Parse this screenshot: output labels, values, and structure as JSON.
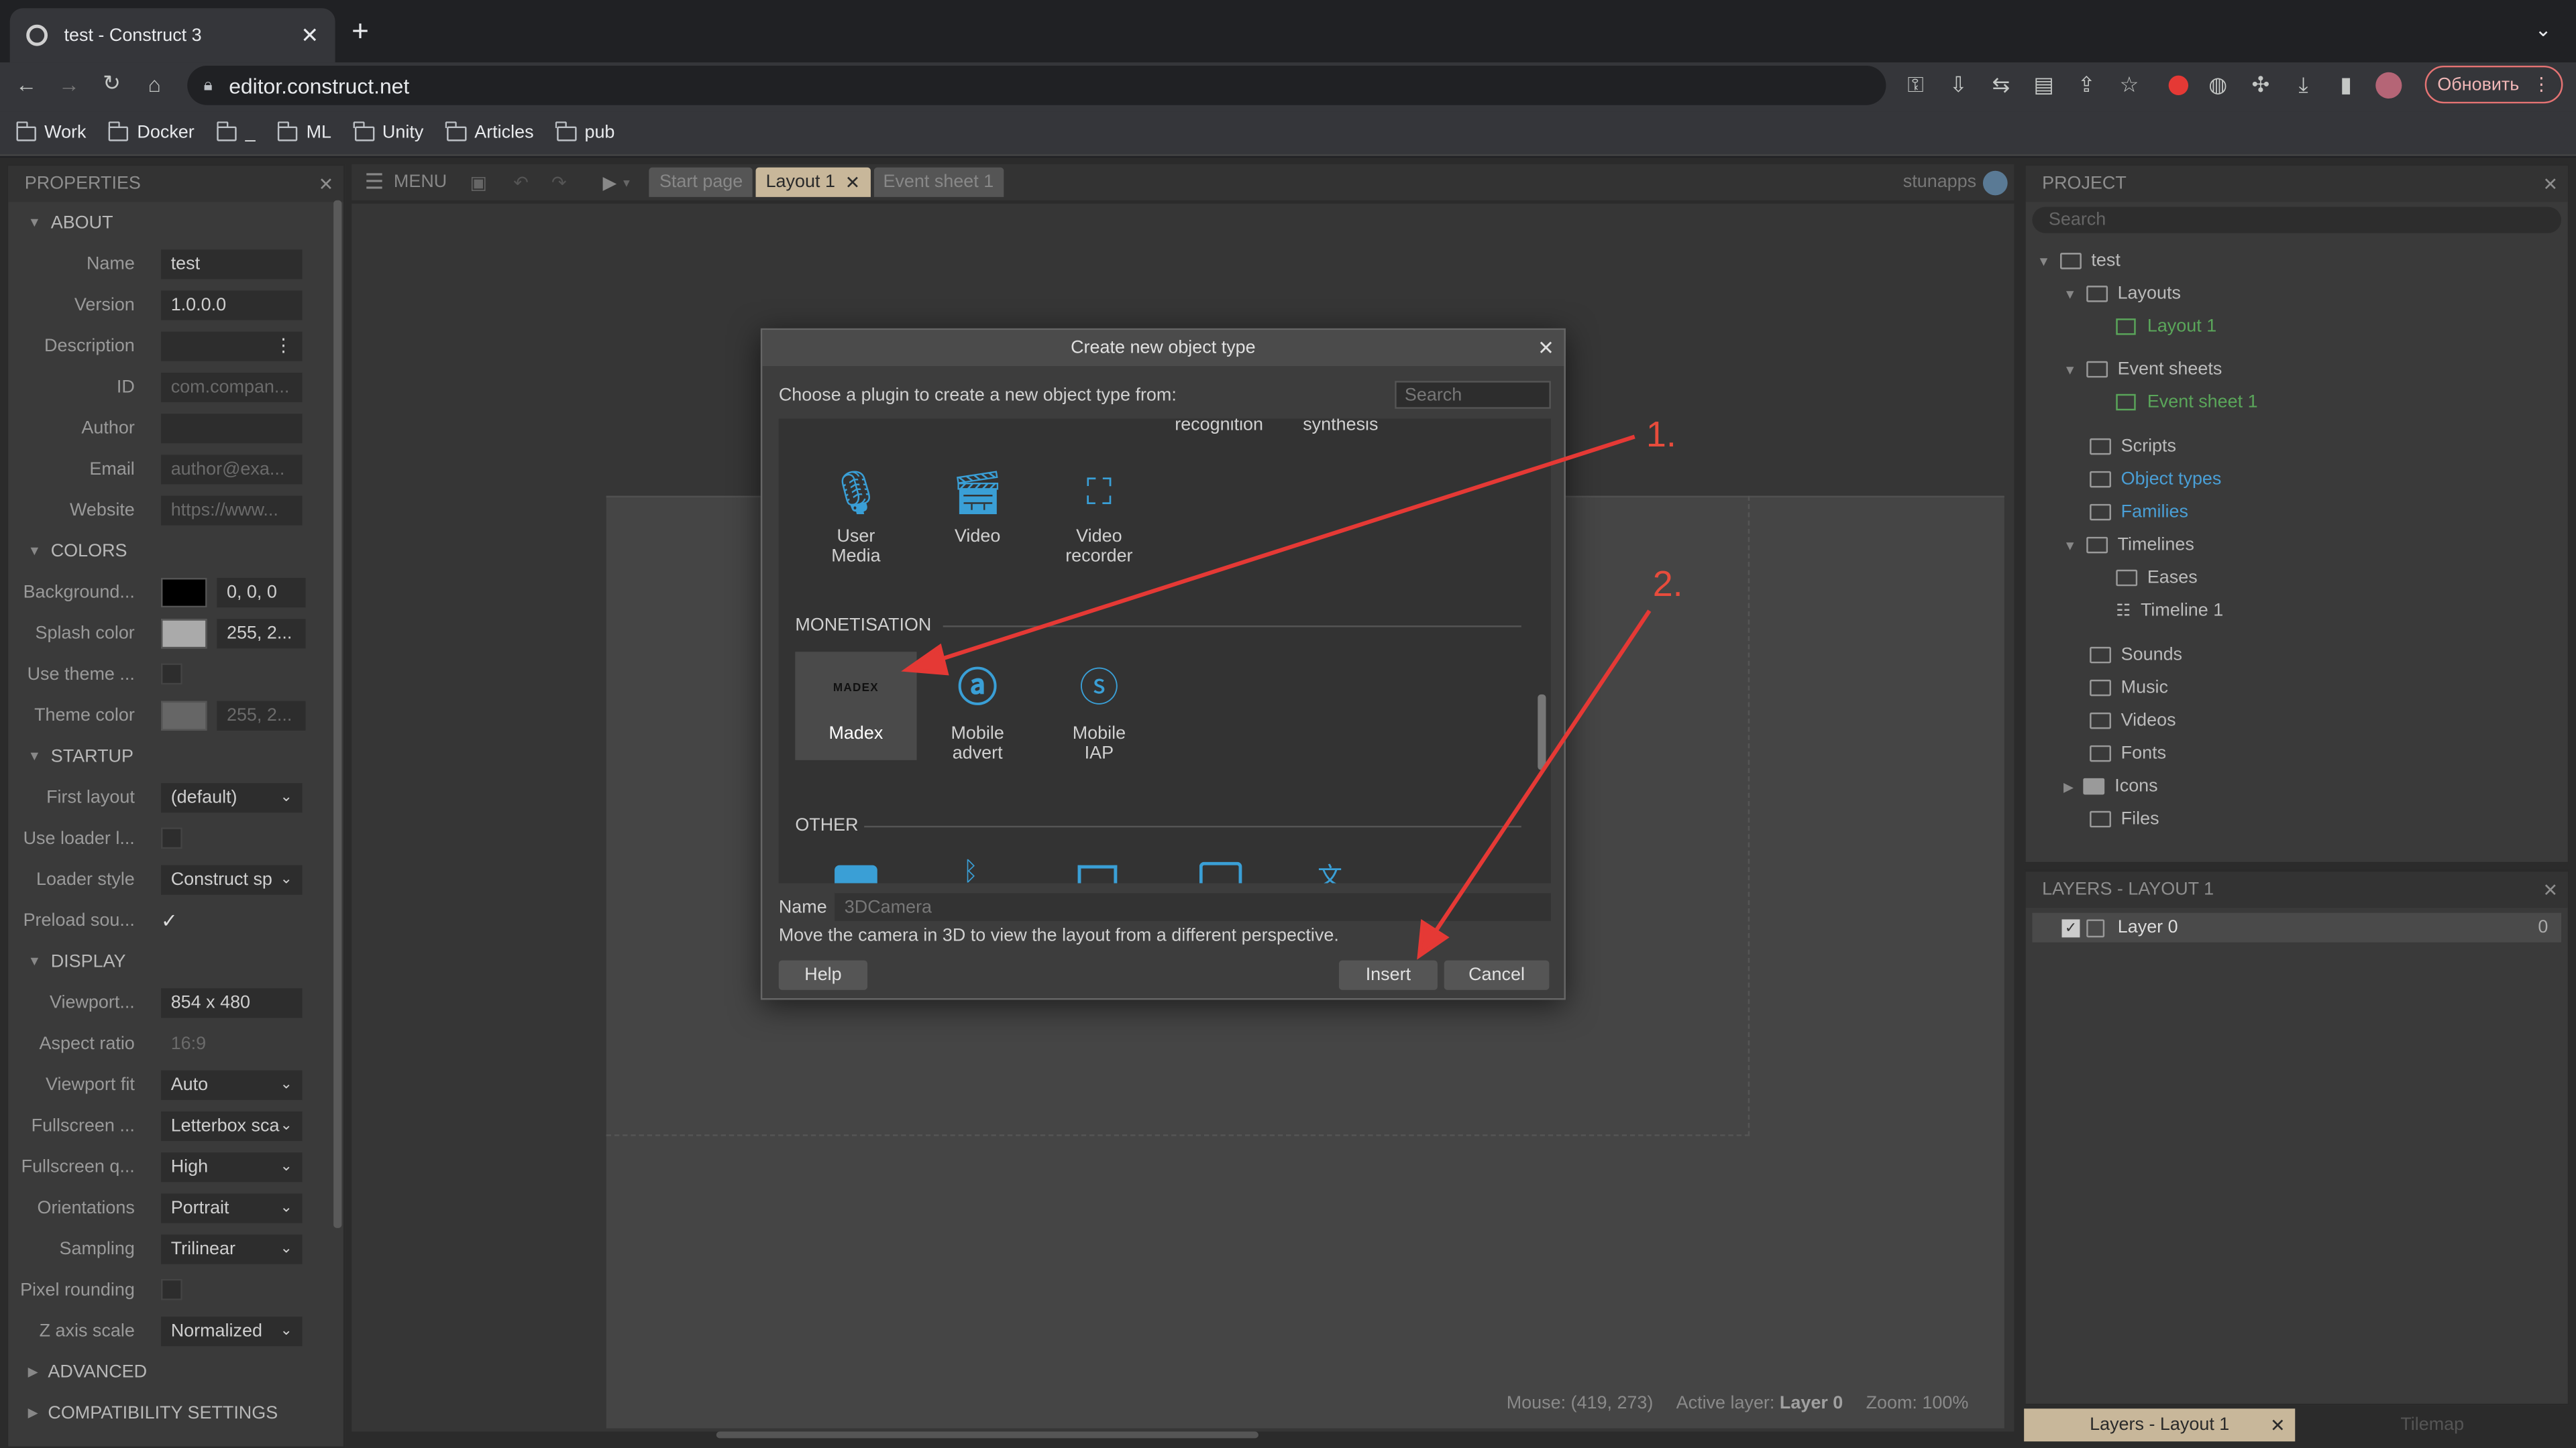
{
  "browser": {
    "tab_title": "test - Construct 3",
    "url": "editor.construct.net",
    "update_button": "Обновить",
    "bookmarks": [
      "Work",
      "Docker",
      "_",
      "ML",
      "Unity",
      "Articles",
      "pub"
    ]
  },
  "editor": {
    "menu_label": "MENU",
    "layout_tabs": [
      "Start page",
      "Layout 1",
      "Event sheet 1"
    ],
    "user": "stunapps",
    "status": {
      "mouse": "Mouse: (419, 273)",
      "active_layer_prefix": "Active layer:",
      "active_layer": "Layer 0",
      "zoom": "Zoom: 100%"
    }
  },
  "properties": {
    "title": "PROPERTIES",
    "sections": {
      "about": "ABOUT",
      "colors": "COLORS",
      "startup": "STARTUP",
      "display": "DISPLAY",
      "advanced": "ADVANCED",
      "compat": "COMPATIBILITY SETTINGS"
    },
    "about": {
      "name_l": "Name",
      "name_v": "test",
      "version_l": "Version",
      "version_v": "1.0.0.0",
      "desc_l": "Description",
      "id_l": "ID",
      "id_v": "com.compan...",
      "author_l": "Author",
      "email_l": "Email",
      "email_v": "author@exa...",
      "website_l": "Website",
      "website_v": "https://www..."
    },
    "colors": {
      "bg_l": "Background...",
      "bg_v": "0, 0, 0",
      "splash_l": "Splash color",
      "splash_v": "255, 2...",
      "usetheme_l": "Use theme ...",
      "theme_l": "Theme color",
      "theme_v": "255, 2..."
    },
    "startup": {
      "first_l": "First layout",
      "first_v": "(default)",
      "useloader_l": "Use loader l...",
      "loaderstyle_l": "Loader style",
      "loaderstyle_v": "Construct sp",
      "preload_l": "Preload sou..."
    },
    "display": {
      "viewport_l": "Viewport...",
      "viewport_v": "854 x 480",
      "aspect_l": "Aspect ratio",
      "aspect_v": "16:9",
      "vpfit_l": "Viewport fit",
      "vpfit_v": "Auto",
      "fs1_l": "Fullscreen ...",
      "fs1_v": "Letterbox sca",
      "fs2_l": "Fullscreen q...",
      "fs2_v": "High",
      "orient_l": "Orientations",
      "orient_v": "Portrait",
      "sampling_l": "Sampling",
      "sampling_v": "Trilinear",
      "pixel_l": "Pixel rounding",
      "zaxis_l": "Z axis scale",
      "zaxis_v": "Normalized"
    }
  },
  "project": {
    "title": "PROJECT",
    "search_placeholder": "Search",
    "tree": {
      "root": "test",
      "layouts": "Layouts",
      "layout1": "Layout 1",
      "eventsheets": "Event sheets",
      "eventsheet1": "Event sheet 1",
      "scripts": "Scripts",
      "objecttypes": "Object types",
      "families": "Families",
      "timelines": "Timelines",
      "eases": "Eases",
      "timeline1": "Timeline 1",
      "sounds": "Sounds",
      "music": "Music",
      "videos": "Videos",
      "fonts": "Fonts",
      "icons": "Icons",
      "files": "Files"
    }
  },
  "layers": {
    "title": "LAYERS - LAYOUT 1",
    "layer_name": "Layer 0",
    "layer_count": "0",
    "bottom_tab_active": "Layers - Layout 1",
    "bottom_tab_inactive": "Tilemap"
  },
  "dialog": {
    "title": "Create new object type",
    "prompt": "Choose a plugin to create a new object type from:",
    "search_placeholder": "Search",
    "top_partial": [
      "recognition",
      "synthesis"
    ],
    "row1": [
      {
        "label": "User Media",
        "icon": "microphone-camera-icon"
      },
      {
        "label": "Video",
        "icon": "video-clapper-icon"
      },
      {
        "label": "Video recorder",
        "icon": "video-recorder-icon"
      }
    ],
    "category_monetisation": "MONETISATION",
    "row2": [
      {
        "label": "Madex",
        "icon": "madex-logo"
      },
      {
        "label": "Mobile advert",
        "icon": "mobile-advert-icon"
      },
      {
        "label": "Mobile IAP",
        "icon": "dollar-coin-icon"
      }
    ],
    "madex_logo_text": "MADEX",
    "category_other": "OTHER",
    "name_label": "Name",
    "name_value": "3DCamera",
    "description": "Move the camera in 3D to view the layout from a different perspective.",
    "help": "Help",
    "insert": "Insert",
    "cancel": "Cancel"
  },
  "annotations": {
    "step1": "1.",
    "step2": "2.",
    "color": "#e53935"
  }
}
